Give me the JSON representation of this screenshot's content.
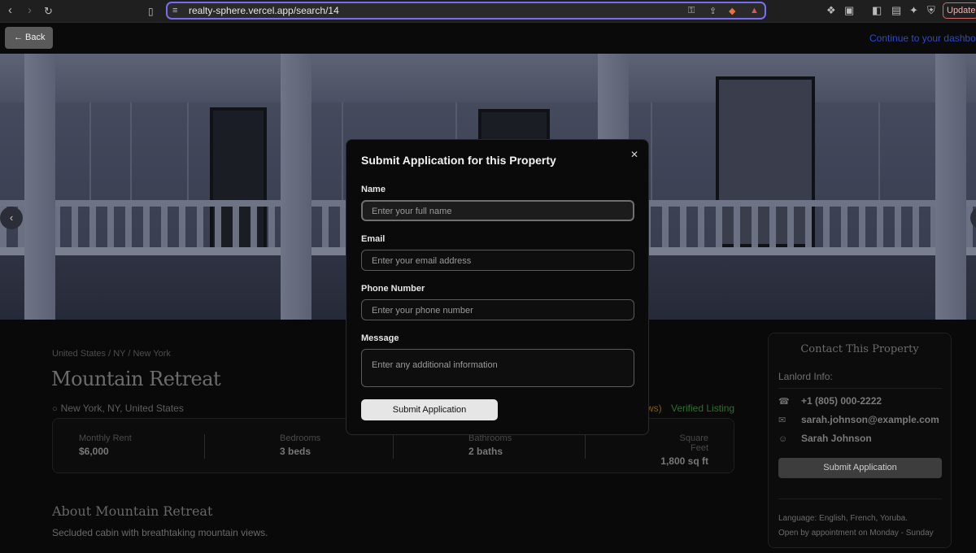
{
  "browser": {
    "url": "realty-sphere.vercel.app/search/14",
    "update_label": "Update"
  },
  "topnav": {
    "back_label": "← Back",
    "dashboard_link": "Continue to your dashbo"
  },
  "property": {
    "breadcrumb": "United States / NY / New York",
    "title": "Mountain Retreat",
    "location": "New York, NY, United States",
    "reviews_fragment": "ws)",
    "verified": "Verified Listing",
    "stats": [
      {
        "label": "Monthly Rent",
        "value": "$6,000"
      },
      {
        "label": "Bedrooms",
        "value": "3 beds"
      },
      {
        "label": "Bathrooms",
        "value": "2 baths"
      },
      {
        "label": "Square Feet",
        "value": "1,800 sq ft"
      }
    ],
    "about_title": "About Mountain Retreat",
    "about_text": "Secluded cabin with breathtaking mountain views."
  },
  "contact": {
    "title": "Contact This Property",
    "info_label": "Lanlord Info:",
    "phone": "+1 (805) 000-2222",
    "email": "sarah.johnson@example.com",
    "name": "Sarah Johnson",
    "button": "Submit Application",
    "language": "Language: English, French, Yoruba.",
    "hours": "Open by appointment on Monday - Sunday"
  },
  "modal": {
    "title": "Submit Application for this Property",
    "close": "✕",
    "fields": {
      "name_label": "Name",
      "name_placeholder": "Enter your full name",
      "email_label": "Email",
      "email_placeholder": "Enter your email address",
      "phone_label": "Phone Number",
      "phone_placeholder": "Enter your phone number",
      "message_label": "Message",
      "message_placeholder": "Enter any additional information"
    },
    "submit": "Submit Application"
  }
}
